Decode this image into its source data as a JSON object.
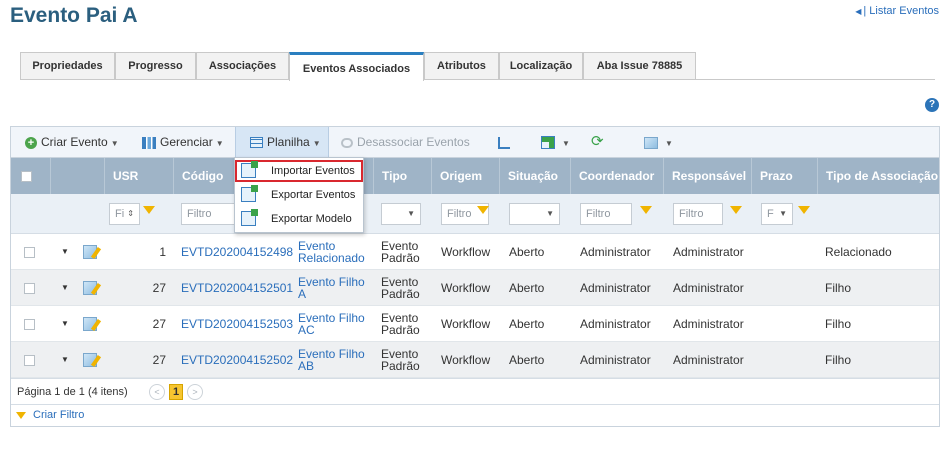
{
  "page_title": "Evento Pai A",
  "list_link": "| Listar Eventos",
  "tabs": [
    {
      "label": "Propriedades"
    },
    {
      "label": "Progresso"
    },
    {
      "label": "Associações"
    },
    {
      "label": "Eventos Associados"
    },
    {
      "label": "Atributos"
    },
    {
      "label": "Localização"
    },
    {
      "label": "Aba Issue 78885"
    }
  ],
  "toolbar": {
    "create": "Criar Evento",
    "manage": "Gerenciar",
    "sheet": "Planilha",
    "disassociate": "Desassociar Eventos"
  },
  "sheet_menu": [
    {
      "label": "Importar Eventos"
    },
    {
      "label": "Exportar Eventos"
    },
    {
      "label": "Exportar Modelo"
    }
  ],
  "columns": [
    "USR",
    "Código",
    "Tipo",
    "Origem",
    "Situação",
    "Coordenador",
    "Responsável",
    "Prazo",
    "Tipo de Associação"
  ],
  "filters": {
    "usr": "Fi",
    "code": "Filtro",
    "origin": "Filtro",
    "coordinator": "Filtro",
    "responsible": "Filtro",
    "deadline": "F"
  },
  "rows": [
    {
      "usr": "1",
      "code": "EVTD202004152498",
      "title": "Evento Relacionado",
      "type": "Evento Padrão",
      "origin": "Workflow",
      "status": "Aberto",
      "coordinator": "Administrator",
      "responsible": "Administrator",
      "deadline": "",
      "assoc": "Relacionado"
    },
    {
      "usr": "27",
      "code": "EVTD202004152501",
      "title": "Evento Filho A",
      "type": "Evento Padrão",
      "origin": "Workflow",
      "status": "Aberto",
      "coordinator": "Administrator",
      "responsible": "Administrator",
      "deadline": "",
      "assoc": "Filho"
    },
    {
      "usr": "27",
      "code": "EVTD202004152503",
      "title": "Evento Filho AC",
      "type": "Evento Padrão",
      "origin": "Workflow",
      "status": "Aberto",
      "coordinator": "Administrator",
      "responsible": "Administrator",
      "deadline": "",
      "assoc": "Filho"
    },
    {
      "usr": "27",
      "code": "EVTD202004152502",
      "title": "Evento Filho AB",
      "type": "Evento Padrão",
      "origin": "Workflow",
      "status": "Aberto",
      "coordinator": "Administrator",
      "responsible": "Administrator",
      "deadline": "",
      "assoc": "Filho"
    }
  ],
  "pager": {
    "text": "Página 1 de 1 (4 itens)",
    "current": "1"
  },
  "footer": {
    "create_filter": "Criar Filtro"
  },
  "help": "?"
}
